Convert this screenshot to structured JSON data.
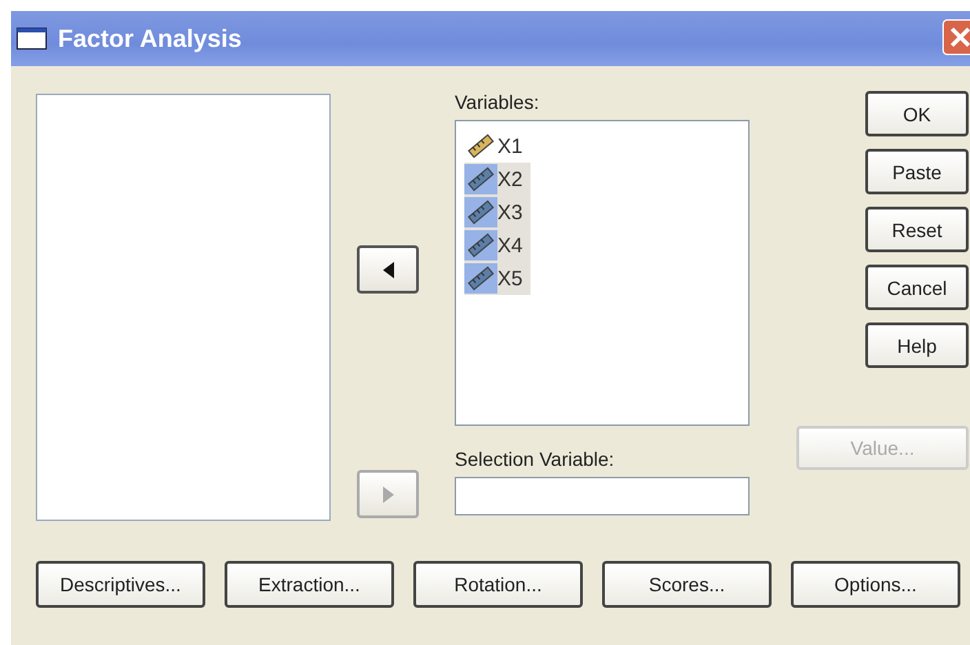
{
  "window": {
    "title": "Factor Analysis"
  },
  "move_buttons": [
    {
      "kind": "left",
      "disabled": false
    },
    {
      "kind": "right",
      "disabled": true
    }
  ],
  "variables": {
    "label": "Variables:",
    "items": [
      {
        "name": "X1",
        "selected": false
      },
      {
        "name": "X2",
        "selected": true
      },
      {
        "name": "X3",
        "selected": true
      },
      {
        "name": "X4",
        "selected": true
      },
      {
        "name": "X5",
        "selected": true
      }
    ]
  },
  "selection_variable": {
    "label": "Selection Variable:"
  },
  "value_button": {
    "label": "Value...",
    "disabled": true
  },
  "side_buttons": [
    "OK",
    "Paste",
    "Reset",
    "Cancel",
    "Help"
  ],
  "bottom_buttons": [
    "Descriptives...",
    "Extraction...",
    "Rotation...",
    "Scores...",
    "Options..."
  ]
}
